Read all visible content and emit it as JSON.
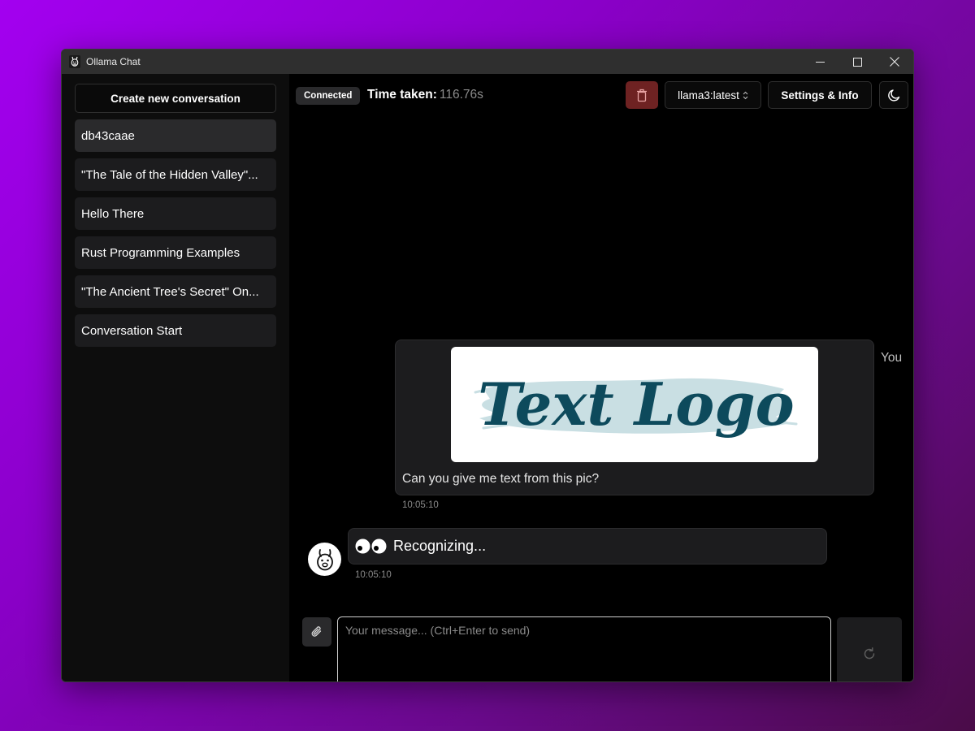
{
  "window": {
    "title": "Ollama Chat",
    "controls": [
      "minimize-icon",
      "maximize-icon",
      "close-icon"
    ]
  },
  "sidebar": {
    "new_conversation_label": "Create new conversation",
    "conversations": [
      {
        "label": "db43caae",
        "active": true
      },
      {
        "label": "\"The Tale of the Hidden Valley\"...",
        "active": false
      },
      {
        "label": "Hello There",
        "active": false
      },
      {
        "label": "Rust Programming Examples",
        "active": false
      },
      {
        "label": "\"The Ancient Tree's Secret\" On...",
        "active": false
      },
      {
        "label": "Conversation Start",
        "active": false
      }
    ]
  },
  "header": {
    "status": "Connected",
    "time_label": "Time taken:",
    "time_value": "116.76s",
    "delete_icon": "trash-icon",
    "model": "llama3:latest",
    "settings_label": "Settings & Info",
    "theme_icon": "moon-icon"
  },
  "chat": {
    "user_message": {
      "sender": "You",
      "image_text": "Text Logo",
      "text": "Can you give me text from this pic?",
      "timestamp": "10:05:10"
    },
    "bot_message": {
      "avatar_icon": "llama-avatar-icon",
      "text": "Recognizing...",
      "timestamp": "10:05:10"
    }
  },
  "composer": {
    "attach_icon": "paperclip-icon",
    "placeholder": "Your message... (Ctrl+Enter to send)",
    "value": "",
    "send_icon": "refresh-icon"
  },
  "colors": {
    "background_gradient": [
      "#a300f0",
      "#4a0c48"
    ],
    "delete_button": "#6e2222",
    "logo_text": "#0d4a5c",
    "logo_brush": "#c9dfe3"
  }
}
